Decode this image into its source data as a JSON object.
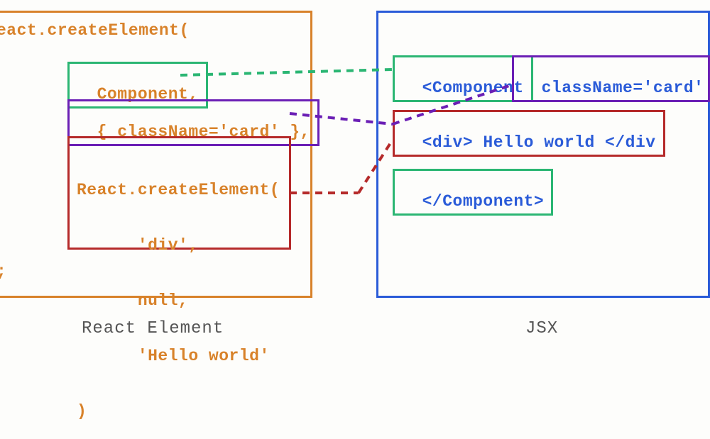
{
  "left": {
    "caption": "React Element",
    "line1": "eact.createElement(",
    "component": "Component,",
    "props": "{ className='card' },",
    "child_line1": "React.createElement(",
    "child_line2": "      'div',",
    "child_line3": "      null,",
    "child_line4": "      'Hello world'",
    "child_line5": ")",
    "semicolon": ";"
  },
  "right": {
    "caption": "JSX",
    "component_open": "<Component",
    "className": "className='card'",
    "child": "<div> Hello world </div",
    "component_close": "</Component>"
  },
  "colors": {
    "orange": "#d8822a",
    "blue": "#2a5bd8",
    "green": "#2bb673",
    "purple": "#6b1fb5",
    "red": "#b52a2a"
  }
}
